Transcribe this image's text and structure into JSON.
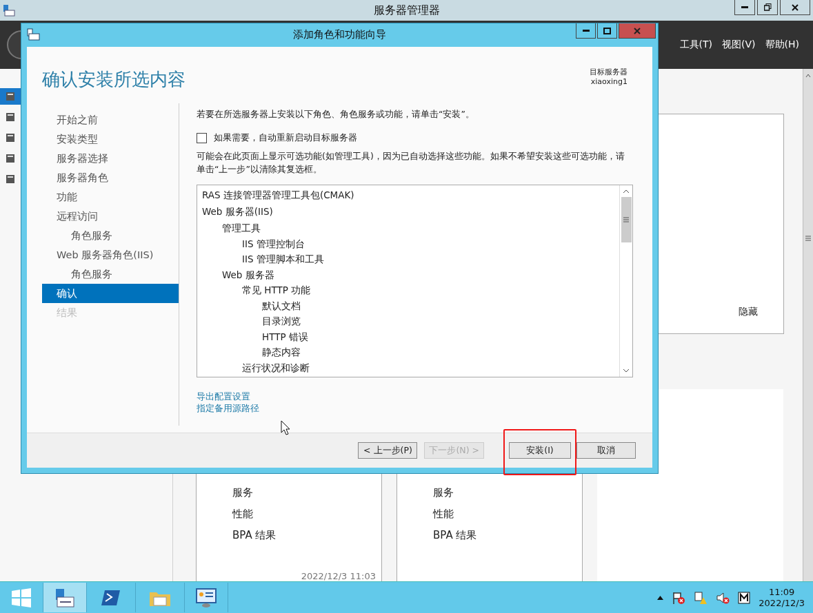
{
  "server_manager": {
    "title": "服务器管理器",
    "menus": [
      "工具(T)",
      "视图(V)",
      "帮助(H)"
    ],
    "nav": [
      {
        "selected": true
      },
      {
        "selected": false
      },
      {
        "selected": false
      },
      {
        "selected": false
      },
      {
        "selected": false
      }
    ],
    "panel": {
      "hide_link": "隐藏"
    },
    "tiles": [
      {
        "items": [
          "服务",
          "性能",
          "BPA 结果"
        ],
        "timestamp": "2022/12/3 11:03"
      },
      {
        "items": [
          "服务",
          "性能",
          "BPA 结果"
        ]
      }
    ]
  },
  "dialog": {
    "title": "添加角色和功能向导",
    "heading": "确认安装所选内容",
    "target_label": "目标服务器",
    "target_name": "xiaoxing1",
    "steps": [
      {
        "label": "开始之前",
        "selected": false,
        "disabled": false
      },
      {
        "label": "安装类型",
        "selected": false,
        "disabled": false
      },
      {
        "label": "服务器选择",
        "selected": false,
        "disabled": false
      },
      {
        "label": "服务器角色",
        "selected": false,
        "disabled": false
      },
      {
        "label": "功能",
        "selected": false,
        "disabled": false
      },
      {
        "label": "远程访问",
        "selected": false,
        "disabled": false,
        "children": [
          {
            "label": "角色服务",
            "selected": false,
            "disabled": false
          }
        ]
      },
      {
        "label": "Web 服务器角色(IIS)",
        "selected": false,
        "disabled": false,
        "children": [
          {
            "label": "角色服务",
            "selected": false,
            "disabled": false
          }
        ]
      },
      {
        "label": "确认",
        "selected": true,
        "disabled": false
      },
      {
        "label": "结果",
        "selected": false,
        "disabled": true
      }
    ],
    "intro": "若要在所选服务器上安装以下角色、角色服务或功能，请单击“安装”。",
    "restart_option": {
      "label": "如果需要，自动重新启动目标服务器",
      "checked": false
    },
    "note": "可能会在此页面上显示可选功能(如管理工具)，因为已自动选择这些功能。如果不希望安装这些可选功能，请单击“上一步”以清除其复选框。",
    "selection": [
      {
        "label": "RAS 连接管理器管理工具包(CMAK)"
      },
      {
        "label": "Web 服务器(IIS)",
        "children": [
          {
            "label": "管理工具",
            "children": [
              {
                "label": "IIS 管理控制台"
              },
              {
                "label": "IIS 管理脚本和工具"
              }
            ]
          },
          {
            "label": "Web 服务器",
            "children": [
              {
                "label": "常见 HTTP 功能",
                "children": [
                  {
                    "label": "默认文档"
                  },
                  {
                    "label": "目录浏览"
                  },
                  {
                    "label": "HTTP 错误"
                  },
                  {
                    "label": "静态内容"
                  }
                ]
              },
              {
                "label": "运行状况和诊断"
              }
            ]
          }
        ]
      }
    ],
    "links": [
      "导出配置设置",
      "指定备用源路径"
    ],
    "buttons": [
      {
        "label": "< 上一步(P)",
        "disabled": false,
        "highlighted": false
      },
      {
        "label": "下一步(N) >",
        "disabled": true,
        "highlighted": false
      },
      {
        "label": "安装(I)",
        "disabled": false,
        "highlighted": true
      },
      {
        "label": "取消",
        "disabled": false,
        "highlighted": false
      }
    ]
  },
  "taskbar": {
    "apps": [
      {
        "selected": true
      },
      {
        "selected": false
      },
      {
        "selected": false
      },
      {
        "selected": false
      }
    ],
    "clock": {
      "time": "11:09",
      "date": "2022/12/3"
    }
  }
}
